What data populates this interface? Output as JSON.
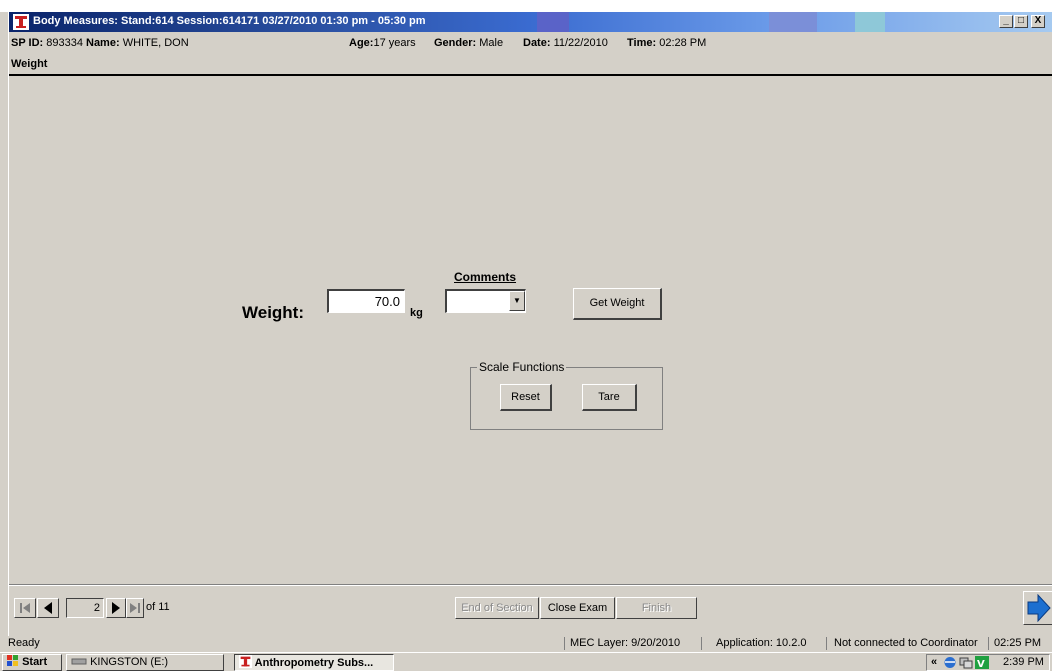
{
  "window": {
    "title": "Body Measures: Stand:614 Session:614171 03/27/2010 01:30 pm - 05:30 pm",
    "controls": {
      "minimize": "_",
      "maximize": "□",
      "close": "X"
    }
  },
  "participant": {
    "sp_id_label": "SP ID:",
    "sp_id": "893334",
    "name_label": "Name:",
    "name": "WHITE, DON",
    "age_label": "Age:",
    "age": "17 years",
    "gender_label": "Gender:",
    "gender": "Male",
    "date_label": "Date:",
    "date": "11/22/2010",
    "time_label": "Time:",
    "time": "02:28 PM"
  },
  "section": {
    "title": "Weight"
  },
  "form": {
    "weight_label": "Weight:",
    "weight_value": "70.0",
    "weight_unit": "kg",
    "comments_label": "Comments",
    "comments_value": "",
    "get_weight_label": "Get Weight",
    "scale_functions_label": "Scale Functions",
    "reset_label": "Reset",
    "tare_label": "Tare"
  },
  "navigation": {
    "current_page": "2",
    "of_pages": "of 11",
    "end_of_section_label": "End of Section",
    "close_exam_label": "Close Exam",
    "finish_label": "Finish"
  },
  "statusbar": {
    "ready": "Ready",
    "mec_layer": "MEC Layer: 9/20/2010",
    "application": "Application: 10.2.0",
    "coordinator": "Not connected to Coordinator",
    "time": "02:25 PM"
  },
  "taskbar": {
    "start_label": "Start",
    "task1": "KINGSTON (E:)",
    "task2": "Anthropometry Subs...",
    "tray_chevron": "«",
    "clock": "2:39 PM"
  },
  "colors": {
    "titlebar_start": "#0a246a",
    "titlebar_end": "#a6caf0",
    "face": "#d4d0c8",
    "next_arrow": "#1c6fd0"
  }
}
